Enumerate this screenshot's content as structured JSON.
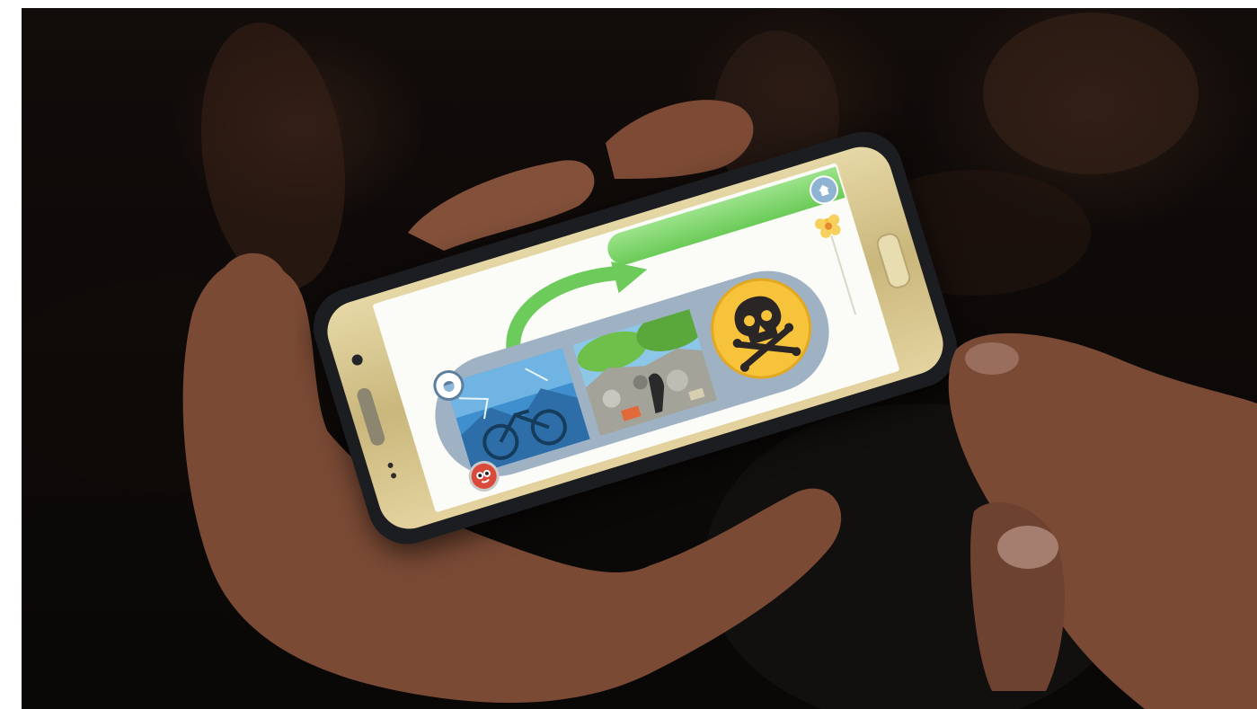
{
  "scene": {
    "description_visible_text": "",
    "background_color": "#120c0a",
    "skin_color": "#7a4a35"
  },
  "phone": {
    "body_color": "#d9c890",
    "case_color": "#1c1d20"
  },
  "app": {
    "top_bar": {
      "color": "#6bcb58",
      "home_icon": "home-icon"
    },
    "flow_arrow": {
      "icon": "curved-arrow-icon",
      "color": "#6ccb5a"
    },
    "track": {
      "color": "#9fb2c4"
    },
    "panels": [
      {
        "name": "bicycle-scene",
        "icon": "magnify-bubble-icon"
      },
      {
        "name": "trash-heap-scene"
      }
    ],
    "hazard": {
      "icon": "skull-crossbones-icon",
      "color": "#f6c33a"
    },
    "flower": {
      "icon": "flower-icon",
      "color": "#f5c542"
    },
    "badge": {
      "icon": "eyes-face-icon",
      "color": "#d94a3a"
    }
  }
}
